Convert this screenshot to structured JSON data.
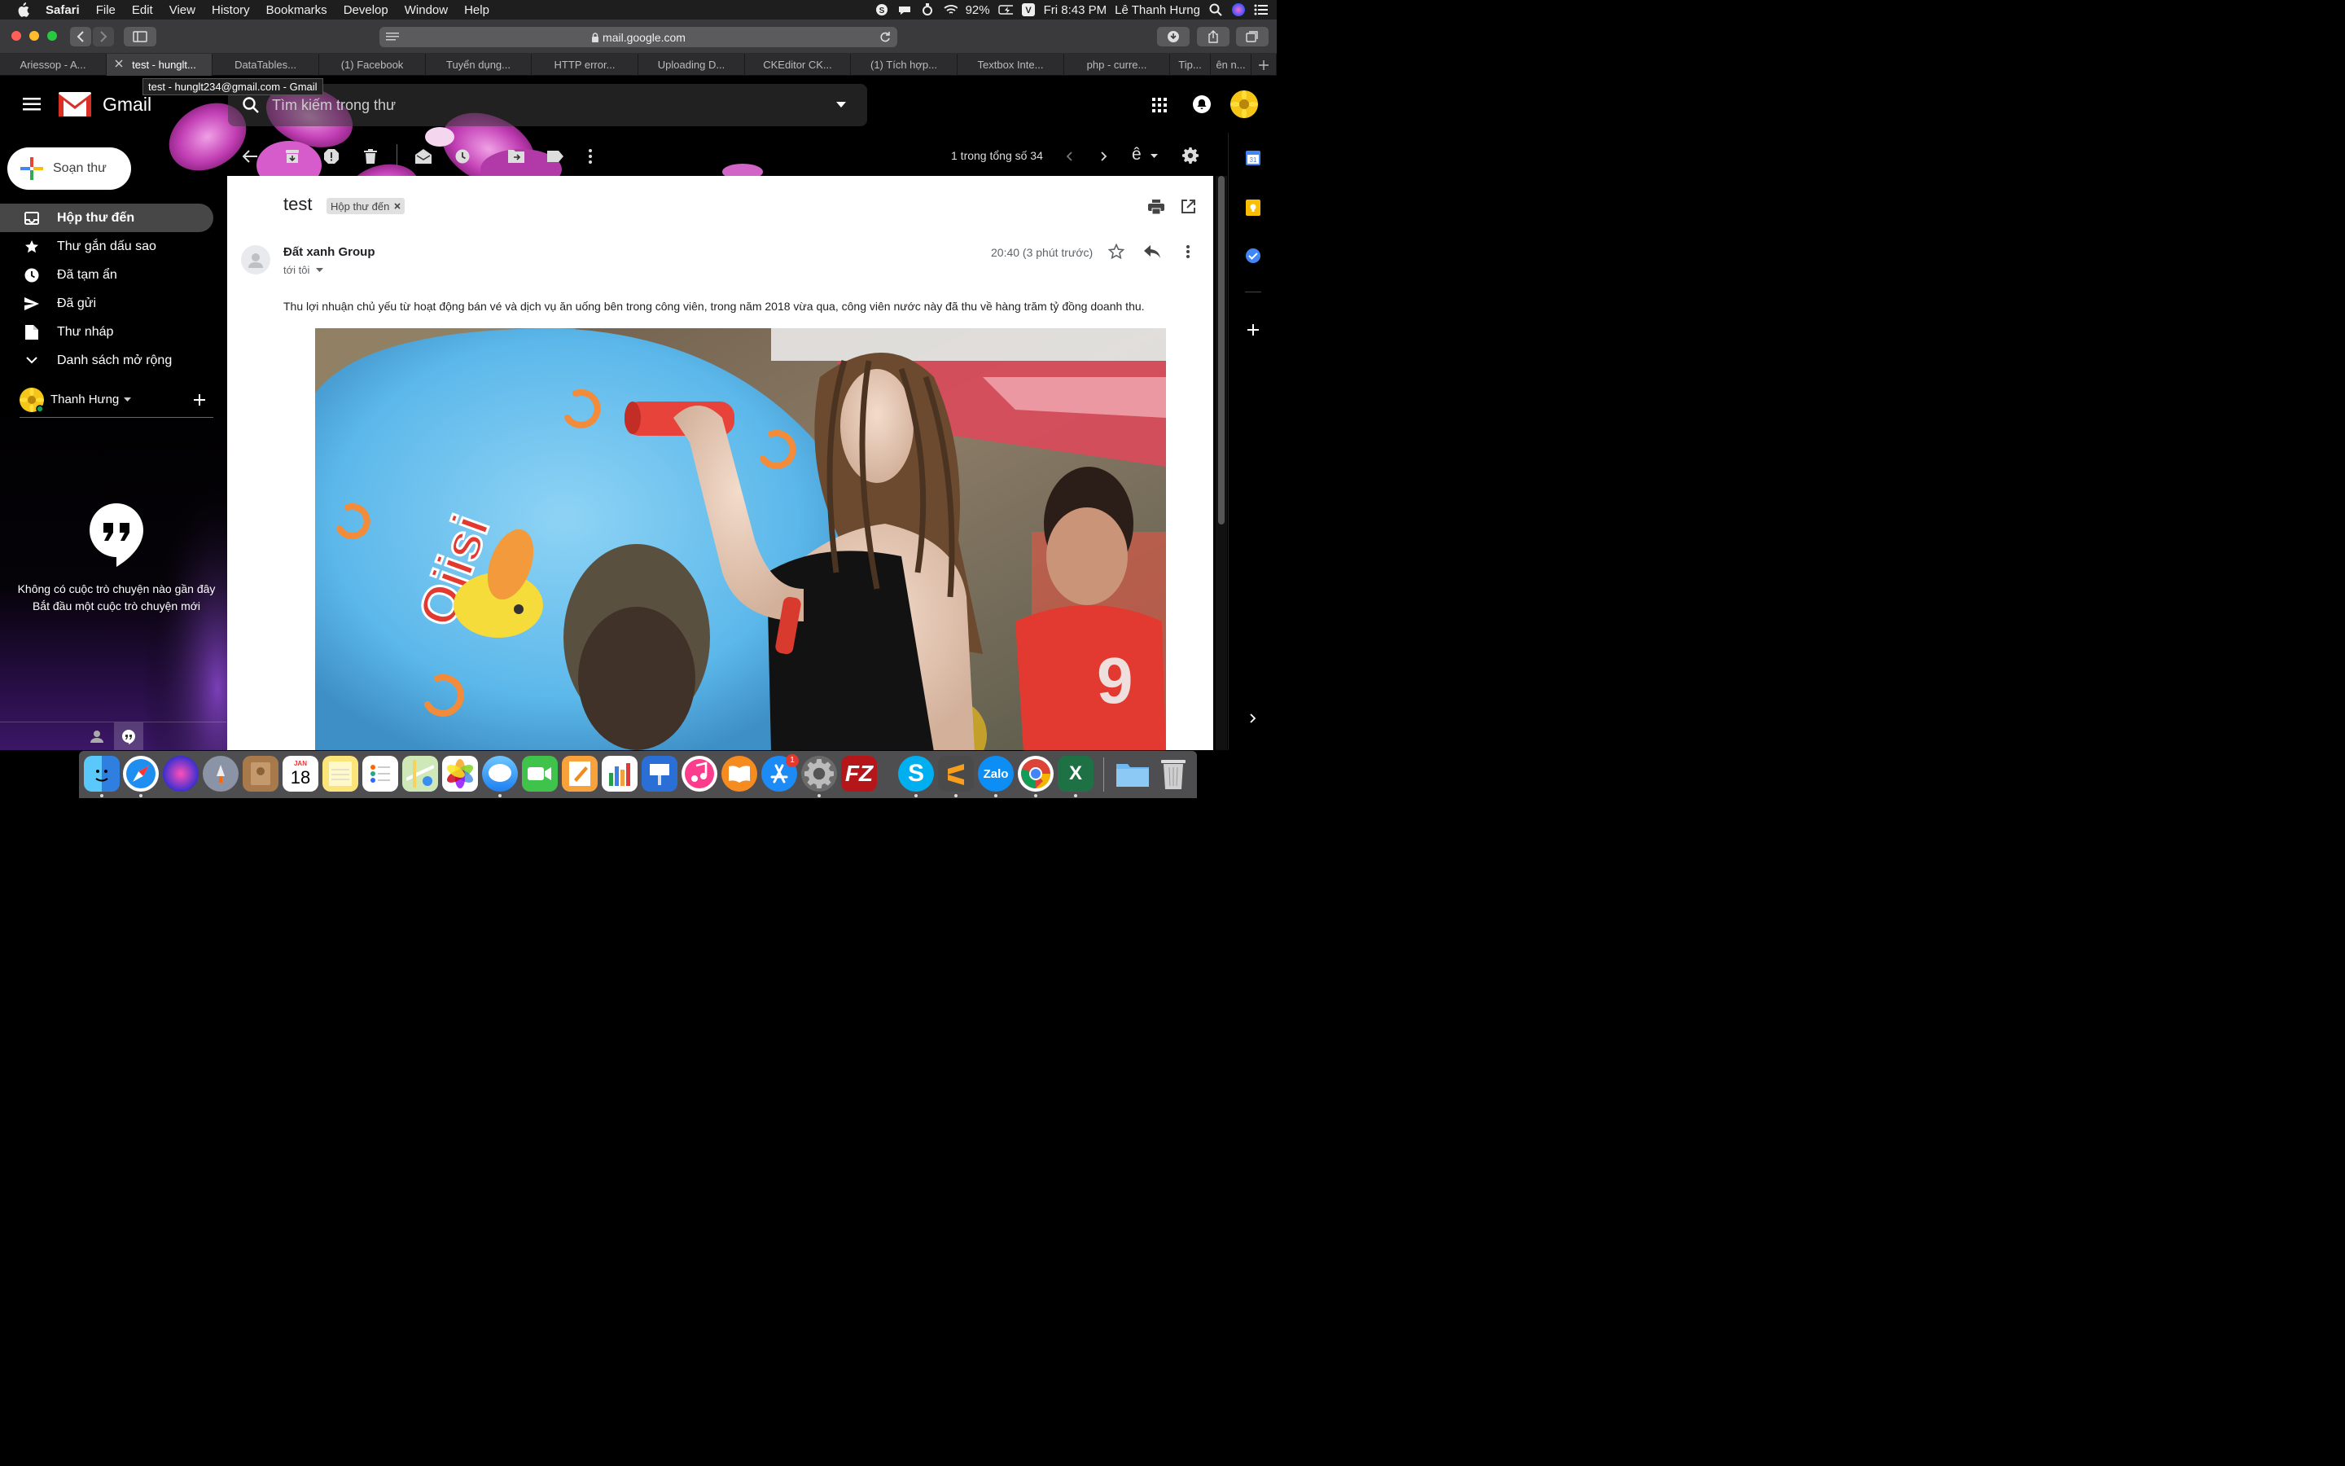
{
  "menubar": {
    "app": "Safari",
    "items": [
      "File",
      "Edit",
      "View",
      "History",
      "Bookmarks",
      "Develop",
      "Window",
      "Help"
    ],
    "battery": "92%",
    "clock": "Fri 8:43 PM",
    "user": "Lê Thanh Hưng"
  },
  "browser": {
    "url": "mail.google.com",
    "tabs": [
      "Ariessop - A...",
      "test - hunglt...",
      "DataTables...",
      "(1) Facebook",
      "Tuyển dụng...",
      "HTTP error...",
      "Uploading D...",
      "CKEditor CK...",
      "(1) Tích hợp...",
      "Textbox Inte...",
      "php - curre...",
      "Tip...",
      "ên n..."
    ],
    "active_tab_index": 1,
    "tooltip": "test - hunglt234@gmail.com - Gmail"
  },
  "gmail": {
    "logo_text": "Gmail",
    "search_placeholder": "Tìm kiếm trong thư",
    "compose_label": "Soạn thư",
    "nav": [
      {
        "label": "Hộp thư đến",
        "icon": "inbox-icon",
        "active": true
      },
      {
        "label": "Thư gắn dấu sao",
        "icon": "star-icon"
      },
      {
        "label": "Đã tạm ẩn",
        "icon": "clock-icon"
      },
      {
        "label": "Đã gửi",
        "icon": "send-icon"
      },
      {
        "label": "Thư nháp",
        "icon": "draft-icon"
      },
      {
        "label": "Danh sách mở rộng",
        "icon": "chevron-down-icon"
      }
    ],
    "hangouts_user": "Thanh Hưng",
    "hangouts_empty_line1": "Không có cuộc trò chuyện nào gần đây",
    "hangouts_empty_line2": "Bắt đầu một cuộc trò chuyện mới",
    "pagination": "1 trong tổng số 34",
    "input_tool": "ê"
  },
  "message": {
    "subject": "test",
    "label": "Hộp thư đến",
    "sender": "Đất xanh Group",
    "to": "tới tôi",
    "time": "20:40 (3 phút trước)",
    "body": "Thu lợi nhuận chủ yếu từ hoạt động bán vé và dịch vụ ăn uống bên trong công viên, trong năm 2018 vừa qua, công viên nước này đã thu về hàng trăm tỷ đồng doanh thu.",
    "image_logo_text": "Ojisi"
  },
  "dock": {
    "calendar_month": "JAN",
    "calendar_day": "18",
    "appstore_badge": "1",
    "zalo_label": "Zalo",
    "apps": [
      "finder",
      "safari",
      "siri",
      "launchpad",
      "contacts",
      "calendar",
      "notes",
      "reminders",
      "maps",
      "photos",
      "messages",
      "facetime",
      "pages",
      "numbers",
      "keynote",
      "itunes",
      "books",
      "app-store",
      "system-preferences",
      "filezilla",
      "skype",
      "sublime-text",
      "zalo",
      "chrome",
      "excel",
      "folder",
      "trash"
    ]
  }
}
